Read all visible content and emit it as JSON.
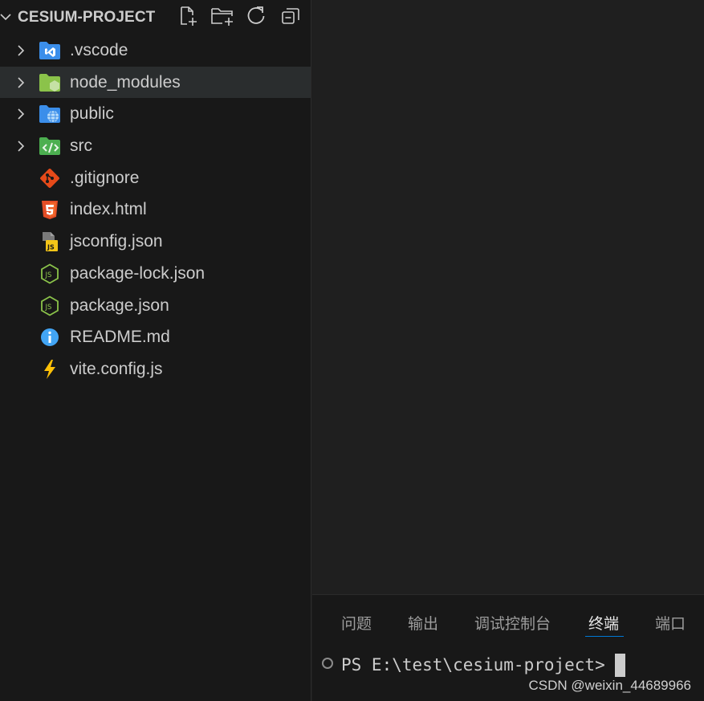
{
  "explorer": {
    "title": "CESIUM-PROJECT",
    "actions": [
      "new-file",
      "new-folder",
      "refresh",
      "collapse-all"
    ],
    "items": [
      {
        "label": ".vscode",
        "kind": "folder",
        "icon": "vscode-folder-icon",
        "color": "#3b8eea"
      },
      {
        "label": "node_modules",
        "kind": "folder",
        "icon": "node-folder-icon",
        "color": "#8bc34a"
      },
      {
        "label": "public",
        "kind": "folder",
        "icon": "public-folder-icon",
        "color": "#3b8eea"
      },
      {
        "label": "src",
        "kind": "folder",
        "icon": "src-folder-icon",
        "color": "#4caf50"
      },
      {
        "label": ".gitignore",
        "kind": "file",
        "icon": "git-icon",
        "color": "#e64a19"
      },
      {
        "label": "index.html",
        "kind": "file",
        "icon": "html5-icon",
        "color": "#e44d26"
      },
      {
        "label": "jsconfig.json",
        "kind": "file",
        "icon": "jsconfig-icon",
        "color": "#f5c518"
      },
      {
        "label": "package-lock.json",
        "kind": "file",
        "icon": "nodejs-icon",
        "color": "#8bc34a"
      },
      {
        "label": "package.json",
        "kind": "file",
        "icon": "nodejs-icon",
        "color": "#8bc34a"
      },
      {
        "label": "README.md",
        "kind": "file",
        "icon": "info-icon",
        "color": "#42a5f5"
      },
      {
        "label": "vite.config.js",
        "kind": "file",
        "icon": "vite-icon",
        "color": "#ffc107"
      }
    ]
  },
  "panel": {
    "tabs": [
      {
        "label": "问题"
      },
      {
        "label": "输出"
      },
      {
        "label": "调试控制台"
      },
      {
        "label": "终端"
      },
      {
        "label": "端口"
      }
    ],
    "active_tab": "终端",
    "accent": "#0078d4",
    "terminal": {
      "prompt": "PS E:\\test\\cesium-project>"
    }
  },
  "watermark": "CSDN @weixin_44689966"
}
